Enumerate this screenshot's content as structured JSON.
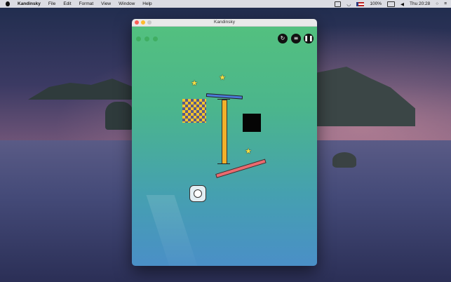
{
  "menubar": {
    "items": [
      "Kandinsky",
      "File",
      "Edit",
      "Format",
      "View",
      "Window",
      "Help"
    ],
    "battery": "100%",
    "clock": "Thu 20:28"
  },
  "window": {
    "title": "Kandinsky",
    "controls": {
      "restart_icon": "restart-icon",
      "menu_icon": "hamburger-icon",
      "pause_icon": "pause-icon"
    }
  },
  "colors": {
    "game_top": "#53c07f",
    "game_bottom": "#4a8fc7",
    "pillar": "#f2b12a",
    "plank_blue": "#4b79d8",
    "plank_red": "#ea6a6f",
    "star": "#f7e045"
  }
}
